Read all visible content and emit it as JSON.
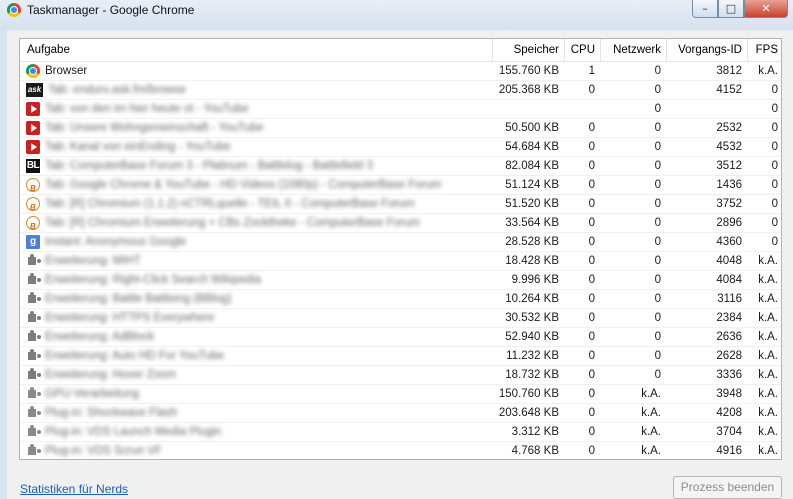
{
  "window": {
    "title": "Taskmanager - Google Chrome",
    "minimize": "–",
    "maximize": "□",
    "close": "✕"
  },
  "table": {
    "columns": [
      "Aufgabe",
      "Speicher",
      "CPU",
      "Netzwerk",
      "Vorgangs-ID",
      "FPS"
    ],
    "rows": [
      {
        "icon": "chrome-icon",
        "name": "Browser",
        "blurred": false,
        "mem": "155.760 KB",
        "cpu": "1",
        "net": "0",
        "pid": "3812",
        "fps": "k.A."
      },
      {
        "icon": "ask-icon",
        "name": "Tab: enduro.ask.fm/browse",
        "blurred": true,
        "mem": "205.368 KB",
        "cpu": "0",
        "net": "0",
        "pid": "4152",
        "fps": "0"
      },
      {
        "icon": "youtube-icon",
        "name": "Tab: von den im hier heute ot - YouTube",
        "blurred": true,
        "mem": "",
        "cpu": "",
        "net": "0",
        "pid": "",
        "fps": "0"
      },
      {
        "icon": "youtube-icon",
        "name": "Tab: Unsere Wohngemeinschaft - YouTube",
        "blurred": true,
        "mem": "50.500 KB",
        "cpu": "0",
        "net": "0",
        "pid": "2532",
        "fps": "0"
      },
      {
        "icon": "youtube-icon",
        "name": "Tab: Kanal von einEnding - YouTube",
        "blurred": true,
        "mem": "54.684 KB",
        "cpu": "0",
        "net": "0",
        "pid": "4532",
        "fps": "0"
      },
      {
        "icon": "bl-icon",
        "name": "Tab: ComputerBase Forum 3 - Platinum - Battlelog - Battlefield 3",
        "blurred": true,
        "mem": "82.084 KB",
        "cpu": "0",
        "net": "0",
        "pid": "3512",
        "fps": "0"
      },
      {
        "icon": "computerbase-icon",
        "name": "Tab: Google Chrome & YouTube - HD Videos (1080p) - ComputerBase Forum",
        "blurred": true,
        "mem": "51.124 KB",
        "cpu": "0",
        "net": "0",
        "pid": "1436",
        "fps": "0"
      },
      {
        "icon": "computerbase-icon",
        "name": "Tab: [R] Chromium (1.1.2) nCTRLquelle - TEIL II - ComputerBase Forum",
        "blurred": true,
        "mem": "51.520 KB",
        "cpu": "0",
        "net": "0",
        "pid": "3752",
        "fps": "0"
      },
      {
        "icon": "computerbase-icon",
        "name": "Tab: [R] Chromium Erweiterung + CBs Zocktheke - ComputerBase Forum",
        "blurred": true,
        "mem": "33.564 KB",
        "cpu": "0",
        "net": "0",
        "pid": "2896",
        "fps": "0"
      },
      {
        "icon": "google-icon",
        "name": "Instant: Anonymous Google",
        "blurred": true,
        "mem": "28.528 KB",
        "cpu": "0",
        "net": "0",
        "pid": "4360",
        "fps": "0"
      },
      {
        "icon": "extension-icon",
        "name": "Erweiterung: MIHT",
        "blurred": true,
        "mem": "18.428 KB",
        "cpu": "0",
        "net": "0",
        "pid": "4048",
        "fps": "k.A."
      },
      {
        "icon": "extension-icon",
        "name": "Erweiterung: Right-Click Search Wikipedia",
        "blurred": true,
        "mem": "9.996 KB",
        "cpu": "0",
        "net": "0",
        "pid": "4084",
        "fps": "k.A."
      },
      {
        "icon": "extension-icon",
        "name": "Erweiterung: Battle Battleing (BBlog)",
        "blurred": true,
        "mem": "10.264 KB",
        "cpu": "0",
        "net": "0",
        "pid": "3116",
        "fps": "k.A."
      },
      {
        "icon": "extension-icon",
        "name": "Erweiterung: HTTPS Everywhere",
        "blurred": true,
        "mem": "30.532 KB",
        "cpu": "0",
        "net": "0",
        "pid": "2384",
        "fps": "k.A."
      },
      {
        "icon": "extension-icon",
        "name": "Erweiterung: AdBlock",
        "blurred": true,
        "mem": "52.940 KB",
        "cpu": "0",
        "net": "0",
        "pid": "2636",
        "fps": "k.A."
      },
      {
        "icon": "extension-icon",
        "name": "Erweiterung: Auto HD For YouTube",
        "blurred": true,
        "mem": "11.232 KB",
        "cpu": "0",
        "net": "0",
        "pid": "2628",
        "fps": "k.A."
      },
      {
        "icon": "extension-icon",
        "name": "Erweiterung: Hover Zoom",
        "blurred": true,
        "mem": "18.732 KB",
        "cpu": "0",
        "net": "0",
        "pid": "3336",
        "fps": "k.A."
      },
      {
        "icon": "plugin-icon",
        "name": "GPU-Verarbeitung",
        "blurred": true,
        "mem": "150.760 KB",
        "cpu": "0",
        "net": "k.A.",
        "pid": "3948",
        "fps": "k.A."
      },
      {
        "icon": "plugin-icon",
        "name": "Plug-in: Shockwave Flash",
        "blurred": true,
        "mem": "203.648 KB",
        "cpu": "0",
        "net": "k.A.",
        "pid": "4208",
        "fps": "k.A."
      },
      {
        "icon": "plugin-icon",
        "name": "Plug-in: VDS Launch Media Plugin",
        "blurred": true,
        "mem": "3.312 KB",
        "cpu": "0",
        "net": "k.A.",
        "pid": "3704",
        "fps": "k.A."
      },
      {
        "icon": "plugin-icon",
        "name": "Plug-in: VDS Scrun VF",
        "blurred": true,
        "mem": "4.768 KB",
        "cpu": "0",
        "net": "k.A.",
        "pid": "4916",
        "fps": "k.A."
      }
    ]
  },
  "footer": {
    "nerds_link": "Statistiken für Nerds",
    "end_process": "Prozess beenden"
  }
}
